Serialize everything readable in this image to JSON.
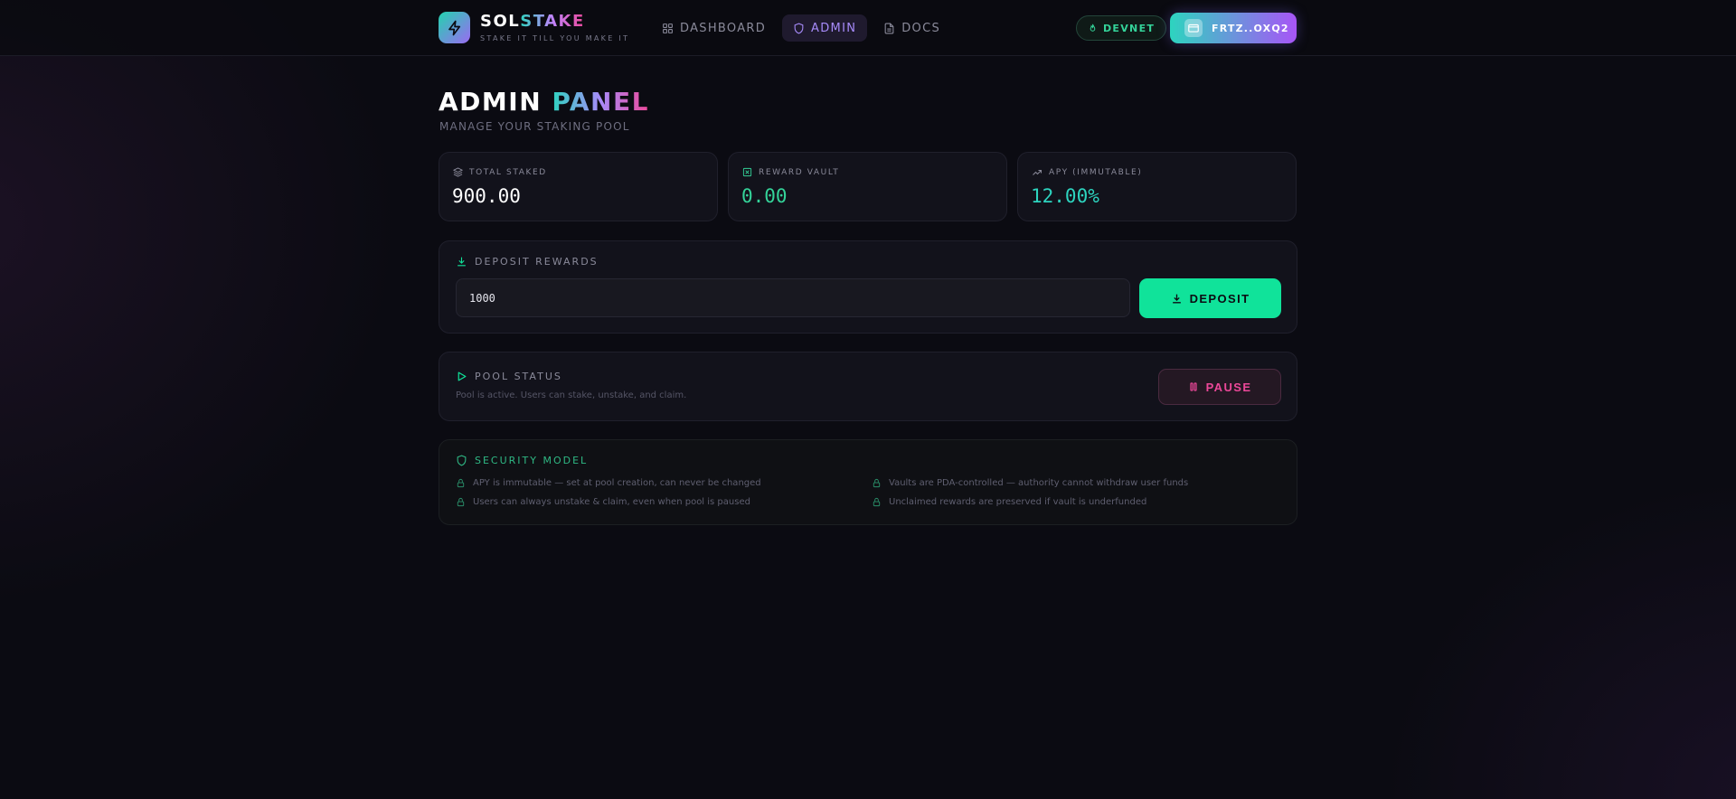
{
  "brand": {
    "name_part1": "SOL",
    "name_part2": "STAKE",
    "tagline": "STAKE IT TILL YOU MAKE IT",
    "logo_icon": "lightning-icon"
  },
  "nav": {
    "items": [
      {
        "label": "DASHBOARD",
        "icon": "grid-icon",
        "active": false
      },
      {
        "label": "ADMIN",
        "icon": "shield-icon",
        "active": true
      },
      {
        "label": "DOCS",
        "icon": "document-icon",
        "active": false
      }
    ]
  },
  "network": {
    "label": "DEVNET",
    "icon": "flame-icon"
  },
  "wallet": {
    "label": "FRTZ..OXQ2",
    "icon": "wallet-icon"
  },
  "page": {
    "title_part1": "ADMIN",
    "title_part2": "PANEL",
    "subtitle": "MANAGE YOUR STAKING POOL"
  },
  "stats": [
    {
      "label": "TOTAL STAKED",
      "value": "900.00",
      "icon": "layers-icon",
      "color": "#ffffff"
    },
    {
      "label": "REWARD VAULT",
      "value": "0.00",
      "icon": "vault-icon",
      "color": "#34d399"
    },
    {
      "label": "APY (IMMUTABLE)",
      "value": "12.00%",
      "icon": "trending-up-icon",
      "color": "#2dd4bf"
    }
  ],
  "deposit": {
    "title": "DEPOSIT REWARDS",
    "input_value": "1000",
    "button_label": "DEPOSIT"
  },
  "pool": {
    "title": "POOL STATUS",
    "description": "Pool is active. Users can stake, unstake, and claim.",
    "button_label": "PAUSE"
  },
  "security": {
    "title": "SECURITY MODEL",
    "items": [
      "APY is immutable — set at pool creation, can never be changed",
      "Vaults are PDA-controlled — authority cannot withdraw user funds",
      "Users can always unstake & claim, even when pool is paused",
      "Unclaimed rewards are preserved if vault is underfunded"
    ]
  },
  "colors": {
    "accent_green": "#10e39a",
    "accent_pink": "#ec4899",
    "accent_purple": "#a78bfa",
    "background": "#0b0b12"
  }
}
